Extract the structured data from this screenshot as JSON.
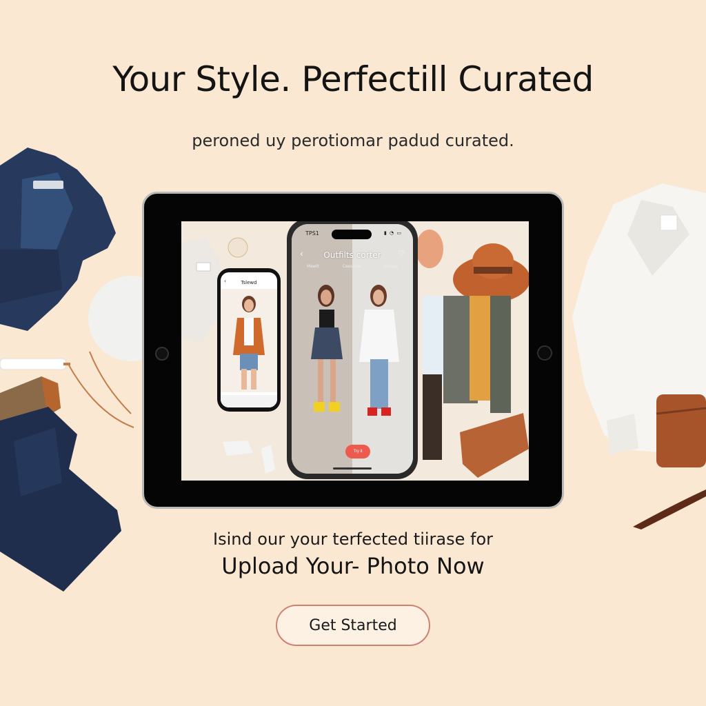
{
  "hero": {
    "title": "Your Style. Perfectill Curated",
    "subtitle": "peroned uy perotiomar padud curated."
  },
  "cta": {
    "prompt": "Isind our your terfected tiirase for",
    "headline": "Upload Your- Photo Now",
    "button_label": "Get Started"
  },
  "tablet": {
    "small_phone": {
      "title": "Tslewd",
      "back_icon": "chevron-left-icon"
    },
    "large_phone": {
      "status_time": "TPS1",
      "status_icons": "signal wifi battery",
      "title": "Outfilts corter",
      "tabs": [
        "Mawlt",
        "Cssoawe",
        "Rheaw"
      ],
      "back_icon": "chevron-left-icon",
      "like_icon": "heart-icon",
      "action_label": "Try it"
    }
  },
  "colors": {
    "background": "#fbe8d2",
    "button_border": "#d0806f",
    "action_pill": "#ef5a4e",
    "tablet_frame": "#050505"
  }
}
